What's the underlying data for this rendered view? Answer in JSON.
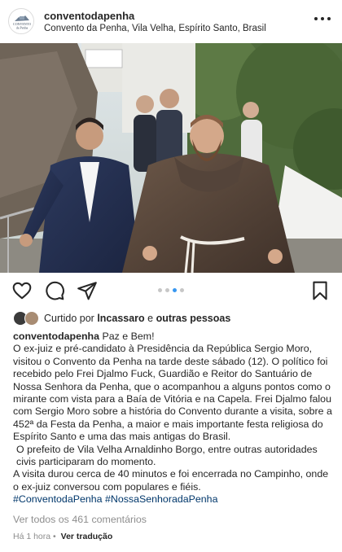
{
  "post": {
    "username": "conventodapenha",
    "location": "Convento da Penha, Vila Velha, Espírito Santo, Brasil",
    "avatar_logo_text": "CONVENTO da Penha"
  },
  "carousel": {
    "count": 4,
    "active": 2
  },
  "likes": {
    "prefix": "Curtido por ",
    "user": "lncassaro",
    "connector": " e ",
    "others": "outras pessoas"
  },
  "caption": {
    "author": "conventodapenha",
    "greeting": " Paz e Bem!",
    "paragraph1": "O ex-juiz e pré-candidato à Presidência da República Sergio Moro, visitou o Convento da Penha na tarde deste sábado (12). O político foi recebido pelo Frei Djalmo Fuck, Guardião e Reitor do Santuário de Nossa Senhora da Penha, que o acompanhou a alguns pontos como o mirante com vista para a Baía de Vitória e na Capela. Frei Djalmo falou com Sergio Moro sobre a história do Convento durante a visita, sobre a 452ª da Festa da Penha, a maior e mais importante festa religiosa do Espírito Santo e uma das mais antigas do Brasil.",
    "paragraph2": "O prefeito de Vila Velha Arnaldinho Borgo, entre outras autoridades civis participaram do momento.",
    "paragraph3": "A visita durou cerca de 40 minutos e foi encerrada no Campinho, onde o ex-juiz conversou com populares e fiéis.",
    "hashtags": "#ConventodaPenha #NossaSenhoradaPenha"
  },
  "comments_link": "Ver todos os 461 comentários",
  "timestamp": "Há 1 hora",
  "separator": " • ",
  "translate_label": "Ver tradução",
  "colors": {
    "link": "#00376b",
    "muted": "#8e8e8e",
    "active_dot": "#3897f0"
  }
}
